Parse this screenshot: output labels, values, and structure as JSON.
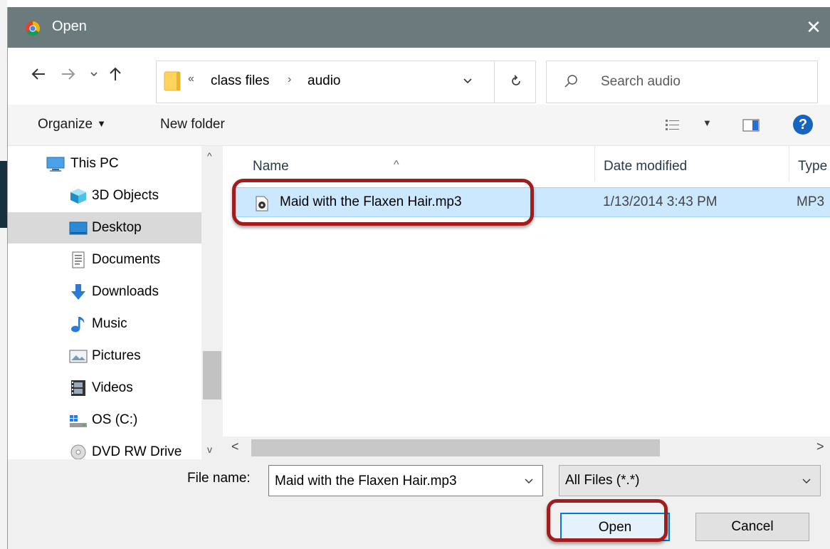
{
  "window": {
    "title": "Open",
    "close_glyph": "✕"
  },
  "address": {
    "overflow_glyph": "«",
    "crumbs": [
      "class files",
      "audio"
    ],
    "separator": "›"
  },
  "search": {
    "placeholder": "Search audio"
  },
  "toolbar": {
    "organize_label": "Organize",
    "organize_arrow": "▼",
    "new_folder_label": "New folder",
    "view_arrow": "▼",
    "help_label": "?"
  },
  "navpane": {
    "items": [
      {
        "label": "This PC",
        "icon": "pc-icon"
      },
      {
        "label": "3D Objects",
        "icon": "cube-icon"
      },
      {
        "label": "Desktop",
        "icon": "desktop-icon",
        "selected": true
      },
      {
        "label": "Documents",
        "icon": "documents-icon"
      },
      {
        "label": "Downloads",
        "icon": "download-arrow-icon"
      },
      {
        "label": "Music",
        "icon": "music-note-icon"
      },
      {
        "label": "Pictures",
        "icon": "pictures-icon"
      },
      {
        "label": "Videos",
        "icon": "film-icon"
      },
      {
        "label": "OS (C:)",
        "icon": "drive-icon"
      },
      {
        "label": "DVD RW Drive",
        "icon": "disc-icon"
      }
    ],
    "scroll_up": "^",
    "scroll_down": "v"
  },
  "filelist": {
    "columns": [
      "Name",
      "Date modified",
      "Type"
    ],
    "sort_caret": "^",
    "rows": [
      {
        "name": "Maid with the Flaxen Hair.mp3",
        "date": "1/13/2014 3:43 PM",
        "type": "MP3"
      }
    ],
    "scroll_left": "<",
    "scroll_right": ">"
  },
  "bottom": {
    "file_name_label": "File name:",
    "file_name_value": "Maid with the Flaxen Hair.mp3",
    "file_type_value": "All Files (*.*)",
    "open_label": "Open",
    "cancel_label": "Cancel"
  },
  "colors": {
    "titlebar": "#6b7b7d",
    "selection": "#cce8ff",
    "highlight_ring": "#a11c1c",
    "accent": "#0078d7"
  }
}
